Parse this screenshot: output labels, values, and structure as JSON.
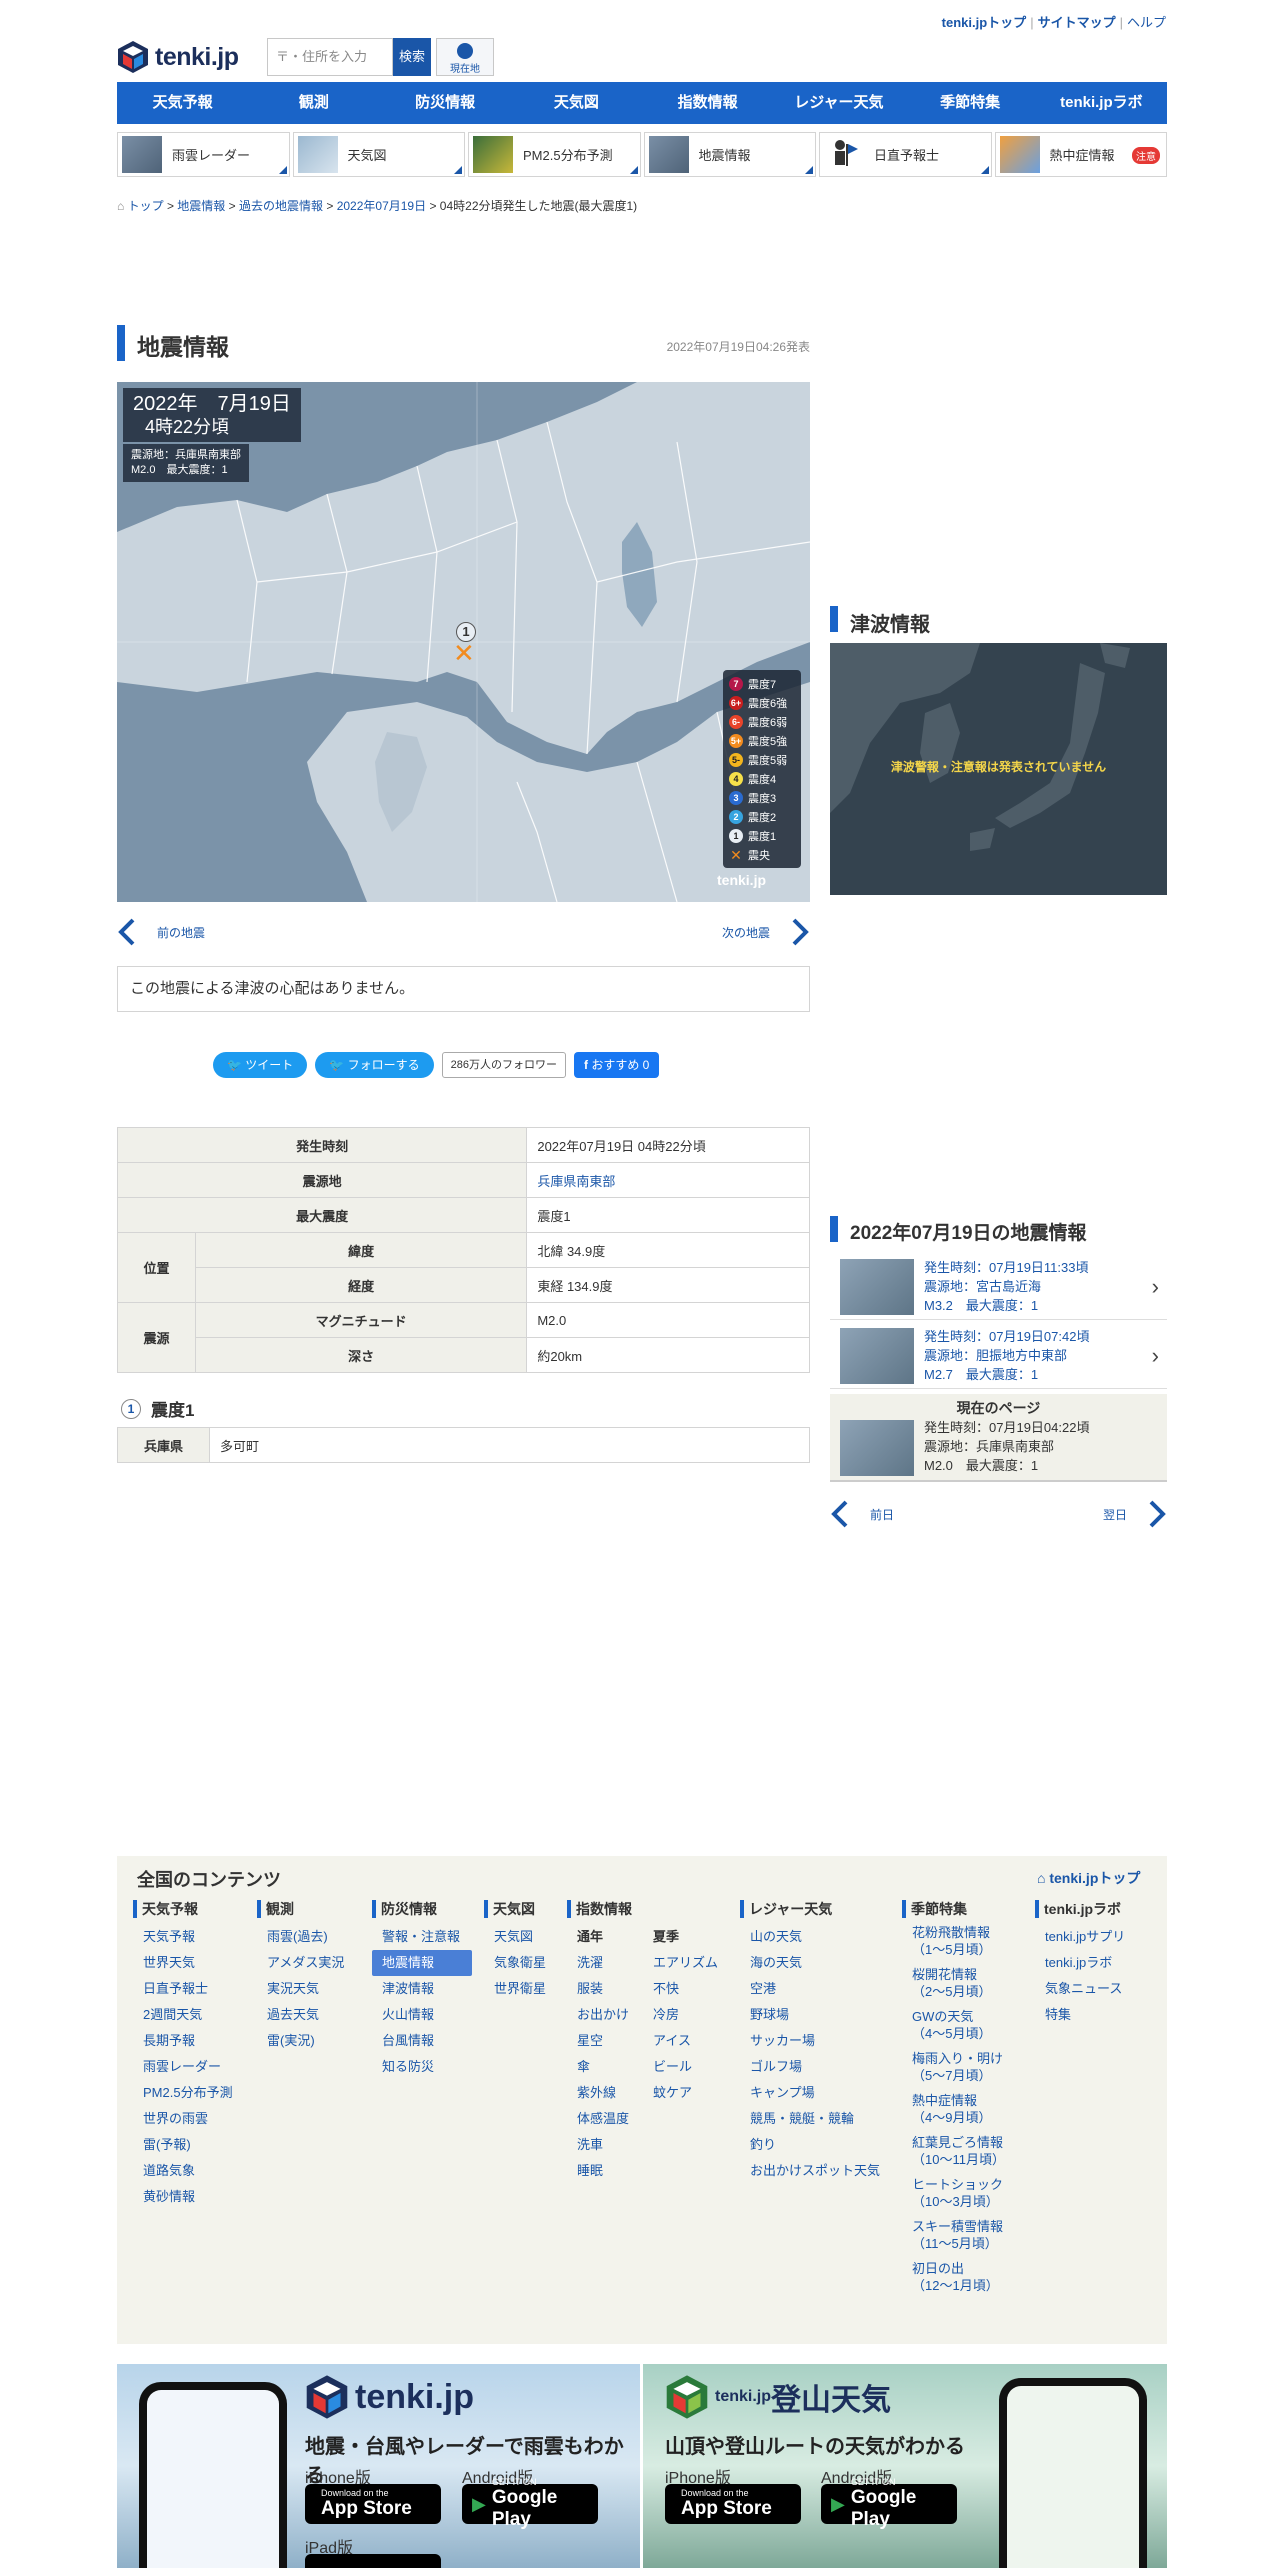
{
  "header": {
    "top_links": [
      "tenki.jpトップ",
      "サイトマップ",
      "ヘルプ"
    ],
    "logo_text": "tenki.jp",
    "search_placeholder": "〒・住所を入力",
    "search_button": "検索",
    "location_button": "現在地"
  },
  "main_nav": [
    "天気予報",
    "観測",
    "防災情報",
    "天気図",
    "指数情報",
    "レジャー天気",
    "季節特集",
    "tenki.jpラボ"
  ],
  "sub_nav": [
    {
      "label": "雨雲レーダー"
    },
    {
      "label": "天気図"
    },
    {
      "label": "PM2.5分布予測"
    },
    {
      "label": "地震情報"
    },
    {
      "label": "日直予報士"
    },
    {
      "label": "熱中症情報",
      "badge": "注意"
    }
  ],
  "breadcrumb": {
    "items": [
      "トップ",
      "地震情報",
      "過去の地震情報",
      "2022年07月19日"
    ],
    "current": "04時22分頃発生した地震(最大震度1)"
  },
  "page": {
    "title": "地震情報",
    "announced": "2022年07月19日04:26発表"
  },
  "map": {
    "date_line1": "2022年　7月19日",
    "date_line2": "4時22分頃",
    "epicenter_line": "震源地：兵庫県南東部",
    "magnitude_line": "M2.0　最大震度：1",
    "epi_intensity": "1",
    "logo": "tenki.jp",
    "legend": [
      {
        "label": "震度7",
        "sym": "7",
        "color": "#b5174a"
      },
      {
        "label": "震度6強",
        "sym": "6+",
        "color": "#c81e1e"
      },
      {
        "label": "震度6弱",
        "sym": "6-",
        "color": "#e8442a"
      },
      {
        "label": "震度5強",
        "sym": "5+",
        "color": "#f28b1e"
      },
      {
        "label": "震度5弱",
        "sym": "5-",
        "color": "#f3b51e"
      },
      {
        "label": "震度4",
        "sym": "4",
        "color": "#f6e04a"
      },
      {
        "label": "震度3",
        "sym": "3",
        "color": "#2a6bd0"
      },
      {
        "label": "震度2",
        "sym": "2",
        "color": "#37a4e0"
      },
      {
        "label": "震度1",
        "sym": "1",
        "color": "#e8eef4"
      },
      {
        "label": "震央",
        "sym": "✕",
        "color": "#f28b1e"
      }
    ]
  },
  "quake_nav": {
    "prev": "前の地震",
    "next": "次の地震"
  },
  "tsunami_note": "この地震による津波の心配はありません。",
  "social": {
    "tweet": "ツイート",
    "follow": "フォローする",
    "followers": "286万人のフォロワー",
    "recommend": "おすすめ 0"
  },
  "details": {
    "occurred_label": "発生時刻",
    "occurred_value": "2022年07月19日 04時22分頃",
    "epicenter_label": "震源地",
    "epicenter_value": "兵庫県南東部",
    "max_int_label": "最大震度",
    "max_int_value": "震度1",
    "position_label": "位置",
    "lat_label": "緯度",
    "lat_value": "北緯 34.9度",
    "lon_label": "経度",
    "lon_value": "東経 134.9度",
    "source_label": "震源",
    "mag_label": "マグニチュード",
    "mag_value": "M2.0",
    "depth_label": "深さ",
    "depth_value": "約20km"
  },
  "intensity": {
    "heading_num": "1",
    "heading": "震度1",
    "pref": "兵庫県",
    "towns": "多可町"
  },
  "tsunami_panel": {
    "title": "津波情報",
    "message": "津波警報・注意報は発表されていません"
  },
  "day_list": {
    "title": "2022年07月19日の地震情報",
    "items": [
      {
        "time": "発生時刻：07月19日11:33頃",
        "epi": "震源地：宮古島近海",
        "mag": "M3.2　最大震度：1"
      },
      {
        "time": "発生時刻：07月19日07:42頃",
        "epi": "震源地：胆振地方中東部",
        "mag": "M2.7　最大震度：1"
      }
    ],
    "current_label": "現在のページ",
    "current": {
      "time": "発生時刻：07月19日04:22頃",
      "epi": "震源地：兵庫県南東部",
      "mag": "M2.0　最大震度：1"
    },
    "prev_day": "前日",
    "next_day": "翌日"
  },
  "footer": {
    "title": "全国のコンテンツ",
    "top_link": "tenki.jpトップ",
    "cols": {
      "forecast": {
        "head": "天気予報",
        "items": [
          "天気予報",
          "世界天気",
          "日直予報士",
          "2週間天気",
          "長期予報",
          "雨雲レーダー",
          "PM2.5分布予測",
          "世界の雨雲",
          "雷(予報)",
          "道路気象",
          "黄砂情報"
        ]
      },
      "observation": {
        "head": "観測",
        "items": [
          "雨雲(過去)",
          "アメダス実況",
          "実況天気",
          "過去天気",
          "雷(実況)"
        ]
      },
      "disaster": {
        "head": "防災情報",
        "items": [
          "警報・注意報",
          "地震情報",
          "津波情報",
          "火山情報",
          "台風情報",
          "知る防災"
        ]
      },
      "chart": {
        "head": "天気図",
        "items": [
          "天気図",
          "気象衛星",
          "世界衛星"
        ]
      },
      "index": {
        "head": "指数情報",
        "sub1": "通年",
        "items1": [
          "洗濯",
          "服装",
          "お出かけ",
          "星空",
          "傘",
          "紫外線",
          "体感温度",
          "洗車",
          "睡眠"
        ],
        "sub2": "夏季",
        "items2": [
          "エアリズム",
          "不快",
          "冷房",
          "アイス",
          "ビール",
          "蚊ケア"
        ]
      },
      "leisure": {
        "head": "レジャー天気",
        "items": [
          "山の天気",
          "海の天気",
          "空港",
          "野球場",
          "サッカー場",
          "ゴルフ場",
          "キャンプ場",
          "競馬・競艇・競輪",
          "釣り",
          "お出かけスポット天気"
        ]
      },
      "season": {
        "head": "季節特集",
        "items": [
          [
            "花粉飛散情報",
            "（1～5月頃）"
          ],
          [
            "桜開花情報",
            "（2～5月頃）"
          ],
          [
            "GWの天気",
            "（4～5月頃）"
          ],
          [
            "梅雨入り・明け",
            "（5～7月頃）"
          ],
          [
            "熱中症情報",
            "（4～9月頃）"
          ],
          [
            "紅葉見ごろ情報",
            "（10～11月頃）"
          ],
          [
            "ヒートショック",
            "（10～3月頃）"
          ],
          [
            "スキー積雪情報",
            "（11～5月頃）"
          ],
          [
            "初日の出",
            "（12～1月頃）"
          ]
        ]
      },
      "lab": {
        "head": "tenki.jpラボ",
        "items": [
          "tenki.jpサプリ",
          "tenki.jpラボ",
          "気象ニュース",
          "特集"
        ]
      }
    }
  },
  "banners": {
    "b1": {
      "title": "tenki.jp",
      "sub": "地震・台風やレーダーで雨雲もわかる",
      "os1": "iPhone版",
      "os2": "Android版",
      "os3": "iPad版"
    },
    "b2": {
      "title_prefix": "tenki.jp",
      "title": "登山天気",
      "sub": "山頂や登山ルートの天気がわかる",
      "os1": "iPhone版",
      "os2": "Android版"
    },
    "appstore_small": "Download on the",
    "appstore": "App Store",
    "gplay_small": "GET IT ON",
    "gplay": "Google Play"
  }
}
